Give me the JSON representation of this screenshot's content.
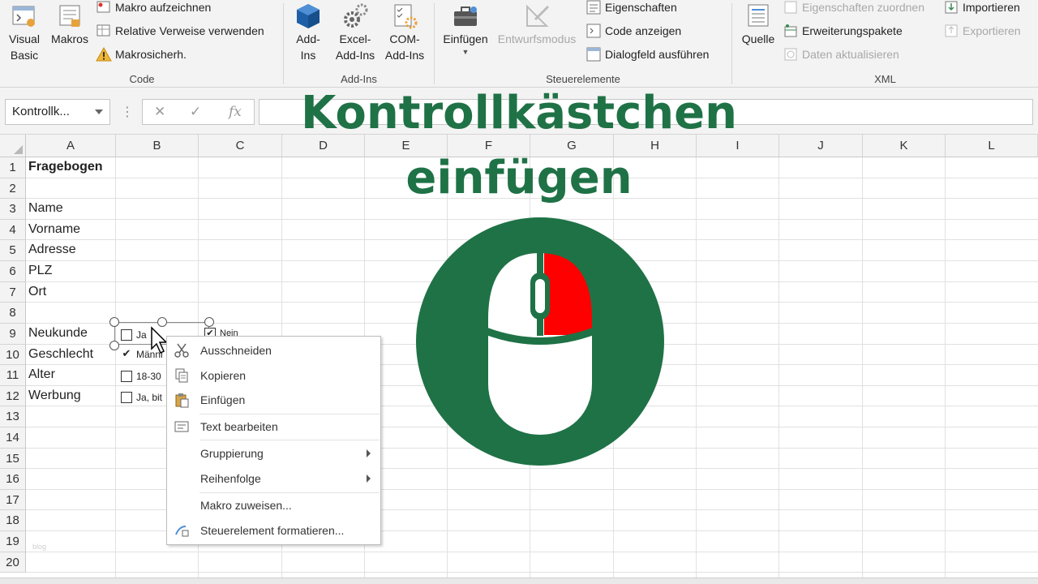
{
  "ribbon": {
    "code_group": {
      "label": "Code",
      "visual_basic": "Visual\nBasic",
      "visual_basic_l1": "Visual",
      "visual_basic_l2": "Basic",
      "macros": "Makros",
      "record_macro": "Makro aufzeichnen",
      "relative_refs": "Relative Verweise verwenden",
      "macro_security": "Makrosicherh."
    },
    "addins_group": {
      "label": "Add-Ins",
      "addins_l1": "Add-",
      "addins_l2": "Ins",
      "excel_addins_l1": "Excel-",
      "excel_addins_l2": "Add-Ins",
      "com_addins_l1": "COM-",
      "com_addins_l2": "Add-Ins"
    },
    "controls_group": {
      "label": "Steuerelemente",
      "insert": "Einfügen",
      "design_mode": "Entwurfsmodus",
      "properties": "Eigenschaften",
      "view_code": "Code anzeigen",
      "run_dialog": "Dialogfeld ausführen"
    },
    "xml_group": {
      "label": "XML",
      "source": "Quelle",
      "map_properties": "Eigenschaften zuordnen",
      "expansion_packs": "Erweiterungspakete",
      "refresh_data": "Daten aktualisieren",
      "import": "Importieren",
      "export": "Exportieren"
    }
  },
  "formula_bar": {
    "name_box": "Kontrollk...",
    "dots": "⋮",
    "cancel": "✕",
    "enter": "✓",
    "fx": "fx"
  },
  "columns": [
    "A",
    "B",
    "C",
    "D",
    "E",
    "F",
    "G",
    "H",
    "I",
    "J",
    "K",
    "L"
  ],
  "rows": [
    "1",
    "2",
    "3",
    "4",
    "5",
    "6",
    "7",
    "8",
    "9",
    "10",
    "11",
    "12",
    "13",
    "14",
    "15",
    "16",
    "17",
    "18",
    "19",
    "20"
  ],
  "cells": {
    "A1": "Fragebogen",
    "A3": "Name",
    "A4": "Vorname",
    "A5": "Adresse",
    "A6": "PLZ",
    "A7": "Ort",
    "A9": "Neukunde",
    "A10": "Geschlecht",
    "A11": "Alter",
    "A12": "Werbung"
  },
  "checkboxes": [
    {
      "label": "Ja",
      "checked": false
    },
    {
      "label": "Nein",
      "checked": true
    },
    {
      "label": "Männl",
      "checked": true
    },
    {
      "label": "18-30",
      "checked": false
    },
    {
      "label": "Ja, bit",
      "checked": false
    }
  ],
  "context_menu": {
    "cut": "Ausschneiden",
    "copy": "Kopieren",
    "paste": "Einfügen",
    "edit_text": "Text bearbeiten",
    "grouping": "Gruppierung",
    "order": "Reihenfolge",
    "assign_macro": "Makro zuweisen...",
    "format_control": "Steuerelement formatieren..."
  },
  "overlay": {
    "title_line1": "Kontrollkästchen",
    "title_line2": "einfügen",
    "logo_icon": "mouse-icon",
    "colors": {
      "green": "#1f7246",
      "red": "#ff0000",
      "white": "#ffffff"
    }
  },
  "watermark": "blog"
}
